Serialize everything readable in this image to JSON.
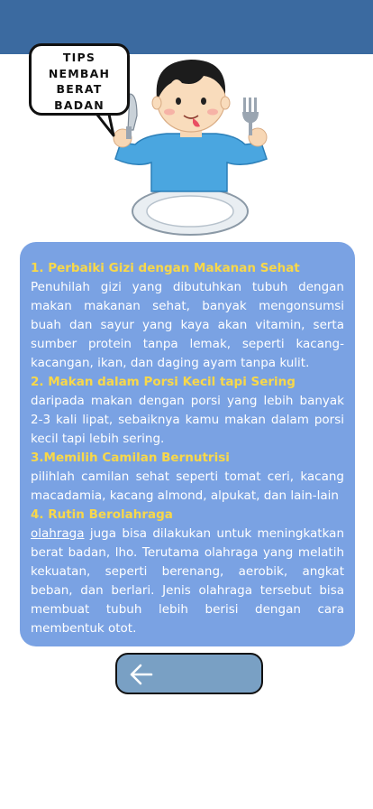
{
  "speech_bubble": {
    "text": "TIPS\nNEMBAH\nBERAT\nBADAN"
  },
  "icons": {
    "illustration": "boy-with-fork-knife-and-plate",
    "back": "arrow-left-icon"
  },
  "colors": {
    "header": "#3b6aa0",
    "card": "#7aa2e3",
    "title": "#f8d84a",
    "back_button": "#79a0c4"
  },
  "tips": [
    {
      "title": "1. Perbaiki Gizi dengan Makanan Sehat",
      "body": "Penuhilah gizi yang dibutuhkan tubuh dengan makan makanan sehat, banyak mengonsumsi buah dan sayur yang kaya akan vitamin, serta sumber protein tanpa lemak, seperti kacang-kacangan, ikan, dan daging ayam tanpa kulit."
    },
    {
      "title": "2. Makan dalam Porsi Kecil tapi Sering",
      "body": "daripada makan dengan porsi yang lebih banyak 2-3 kali lipat, sebaiknya kamu makan dalam porsi kecil tapi lebih sering."
    },
    {
      "title": "3.Memilih Camilan Bernutrisi",
      "body": "pilihlah camilan sehat seperti tomat ceri, kacang macadamia, kacang almond, alpukat, dan lain-lain"
    },
    {
      "title": "4. Rutin Berolahraga",
      "body_link": "olahraga",
      "body": " juga bisa dilakukan untuk meningkatkan berat badan, lho. Terutama olahraga yang melatih kekuatan, seperti berenang, aerobik, angkat beban, dan berlari. Jenis olahraga tersebut bisa membuat tubuh lebih berisi dengan cara membentuk otot."
    }
  ]
}
